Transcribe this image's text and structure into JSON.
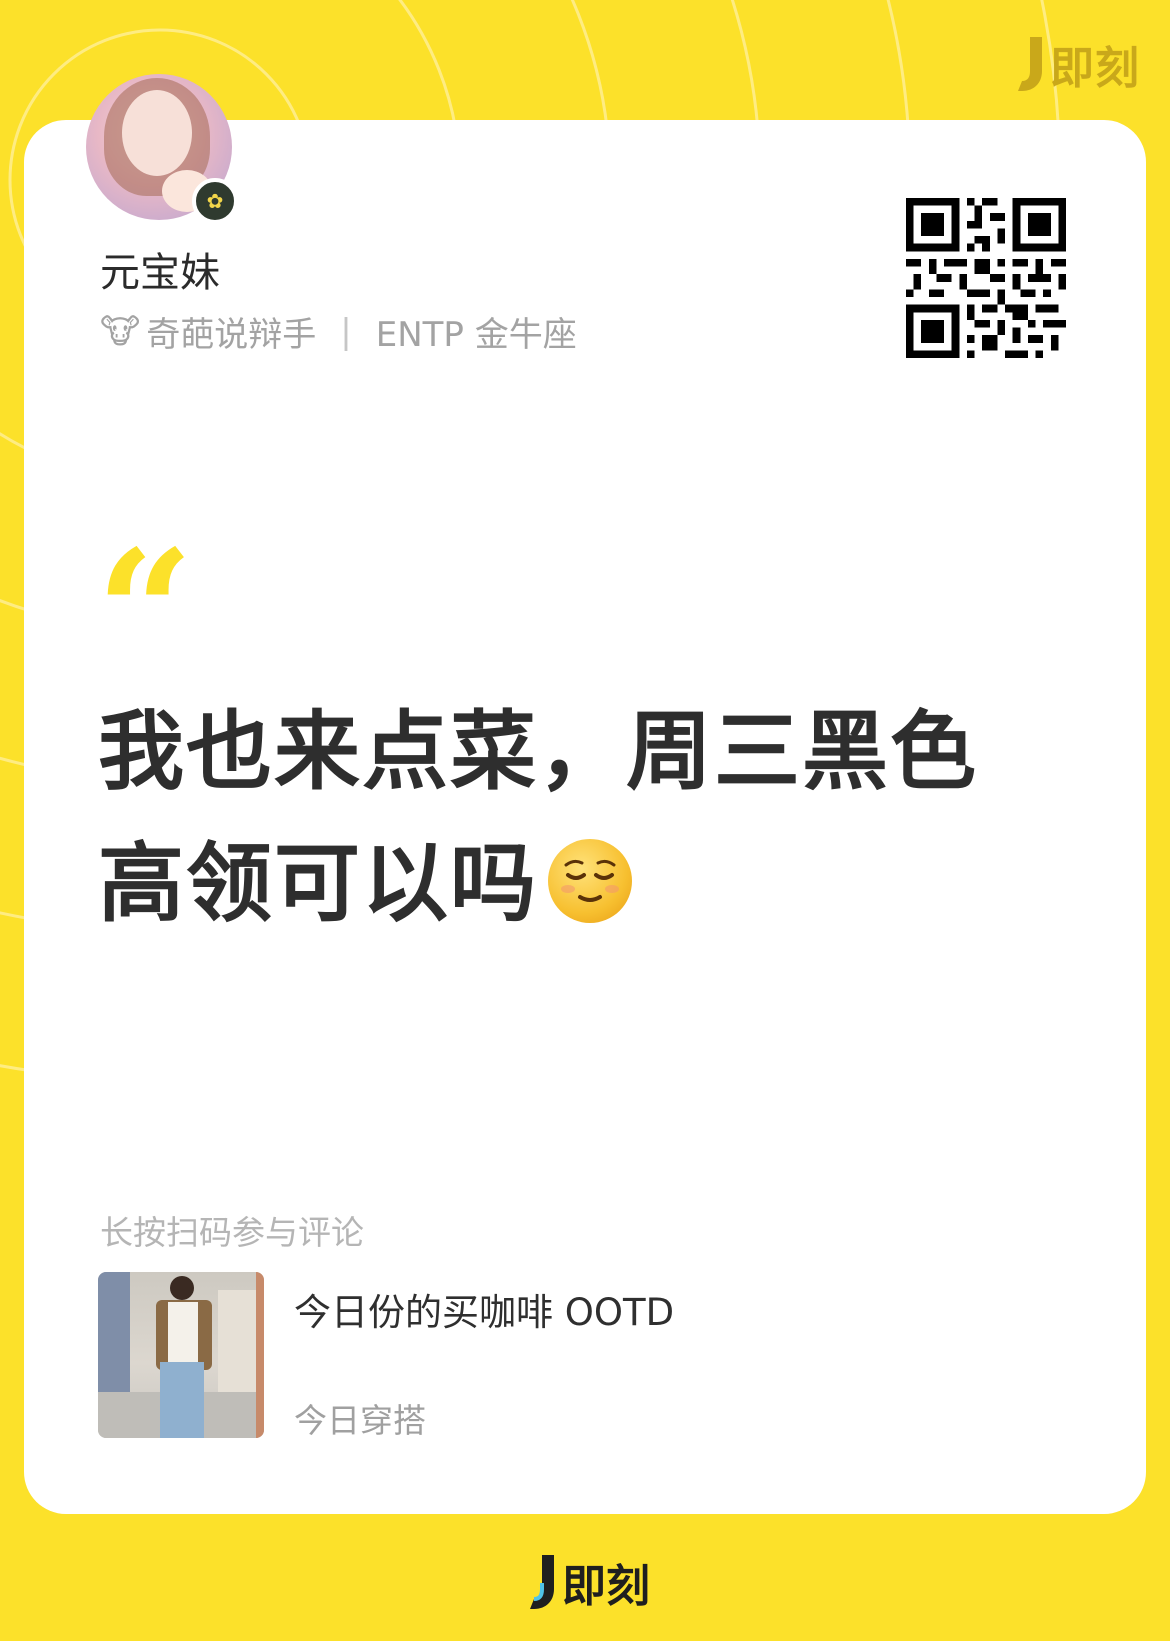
{
  "brand": {
    "name": "即刻",
    "color_yellow": "#FCE12A",
    "color_top_logo": "#C9A81A"
  },
  "author": {
    "name": "元宝妹",
    "bio_emoji": "🐮",
    "bio_title": "奇葩说辩手",
    "bio_separator": "|",
    "bio_tags": "ENTP 金牛座",
    "badge_icon": "verified-flower-icon"
  },
  "post": {
    "quote_mark": "“",
    "text": "我也来点菜，周三黑色高领可以吗",
    "emoji_name": "relieved-face-emoji"
  },
  "footer": {
    "comment_hint": "长按扫码参与评论",
    "topic_title": "今日份的买咖啡 OOTD",
    "topic_subtitle": "今日穿搭"
  }
}
